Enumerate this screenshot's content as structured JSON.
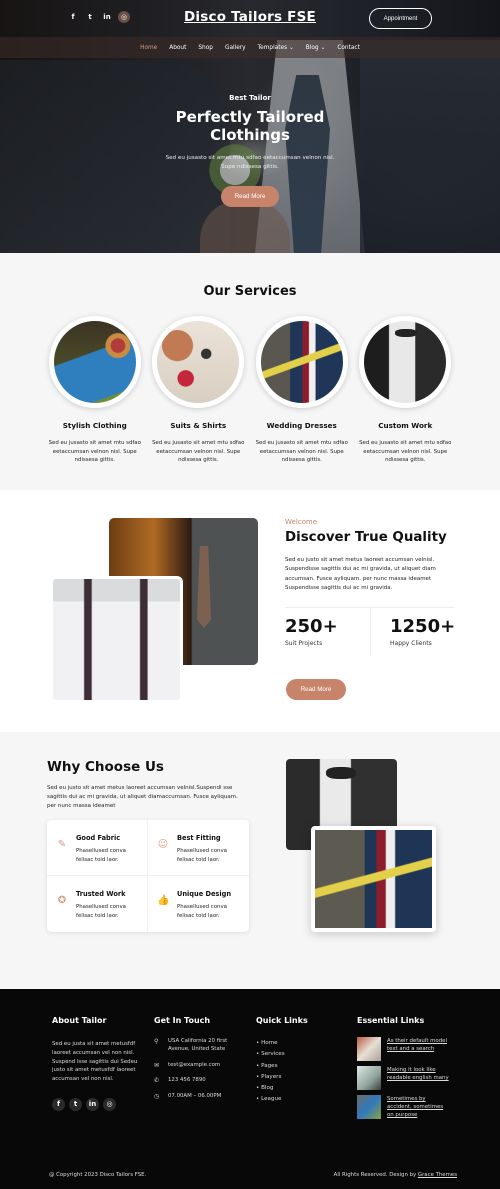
{
  "header": {
    "brand": "Disco Tailors FSE",
    "appointment_label": "Appointment",
    "socials": [
      {
        "icon": "facebook-icon",
        "glyph": "f"
      },
      {
        "icon": "twitter-icon",
        "glyph": "t"
      },
      {
        "icon": "linkedin-icon",
        "glyph": "in"
      },
      {
        "icon": "instagram-icon",
        "glyph": "◎"
      }
    ],
    "nav": [
      {
        "label": "Home",
        "current": true
      },
      {
        "label": "About"
      },
      {
        "label": "Shop"
      },
      {
        "label": "Gallery"
      },
      {
        "label": "Templates ⌄"
      },
      {
        "label": "Blog ⌄"
      },
      {
        "label": "Contact"
      }
    ]
  },
  "hero": {
    "eyebrow": "Best Tailor",
    "title_line1": "Perfectly Tailored",
    "title_line2": "Clothings",
    "text": "Sed eu jusasto sit amet mtu sdfao eetaccumsan velnon nisl. Supe ndissesa gittis.",
    "button": "Read More"
  },
  "services": {
    "title": "Our Services",
    "items": [
      {
        "name": "Stylish Clothing",
        "desc": "Sed eu jusasto sit amet mtu sdfao eetaccumsan velnon nisl. Supe ndissesa gittis.",
        "image": "sewing-machine"
      },
      {
        "name": "Suits & Shirts",
        "desc": "Sed eu jusasto sit amet mtu sdfao eetaccumsan velnon nisl. Supe ndissesa gittis.",
        "image": "buttons-and-thread"
      },
      {
        "name": "Wedding Dresses",
        "desc": "Sed eu jusasto sit amet mtu sdfao eetaccumsan velnon nisl. Supe ndissesa gittis.",
        "image": "measuring-suit"
      },
      {
        "name": "Custom Work",
        "desc": "Sed eu jusasto sit amet mtu sdfao eetaccumsan velnon nisl. Supe ndissesa gittis.",
        "image": "tuxedo"
      }
    ]
  },
  "about": {
    "eyebrow": "Welcome",
    "title": "Discover True Quality",
    "desc": "Sed eu justo sit amet metus laoreet accumsan velnisl. Suspendisse sagittis dui ac mi gravida, ut aliquet diam accumsan. Fusce ayliquam. per nunc massa ideamet Suspendisse sagittis dui ac mi gravida.",
    "stats": [
      {
        "value": "250+",
        "label": "Suit Projects"
      },
      {
        "value": "1250+",
        "label": "Happy Clients"
      }
    ],
    "button": "Read More"
  },
  "why": {
    "title": "Why Choose Us",
    "desc": "Sed eu justo sit amet metus laoreet accumsan velnisl.Suspendi sse sagittis dui ac mi gravida, ut aliquet diamaccumsan. Fusce ayliquam. per nunc massa ideamet",
    "features": [
      {
        "title": "Good Fabric",
        "desc": "Phasellused conva felisac toid laor.",
        "icon": "feather-icon",
        "glyph": "✎"
      },
      {
        "title": "Best Fitting",
        "desc": "Phasellused conva felisac toid laor.",
        "icon": "tailor-icon",
        "glyph": "☺"
      },
      {
        "title": "Trusted Work",
        "desc": "Phasellused conva felisac toid laor.",
        "icon": "award-icon",
        "glyph": "✪"
      },
      {
        "title": "Unique Design",
        "desc": "Phasellused conva felisac toid laor.",
        "icon": "thumbs-up-icon",
        "glyph": "👍"
      }
    ]
  },
  "footer": {
    "about": {
      "title": "About Tailor",
      "text": "Sed eu justa sit amet metusfdf laoreet accumsan vel non nisl. Suspend isse sagittis dui Sedeu justo sit amet metusfdf laoreet accumsan vel non nisl."
    },
    "contact": {
      "title": "Get In Touch",
      "items": [
        {
          "icon": "location-pin-icon",
          "glyph": "⚲",
          "text": "USA California 20 first Avenue, United State"
        },
        {
          "icon": "envelope-icon",
          "glyph": "✉",
          "text": "test@example.com"
        },
        {
          "icon": "phone-icon",
          "glyph": "✆",
          "text": "123 456 7890"
        },
        {
          "icon": "clock-icon",
          "glyph": "◷",
          "text": "07.00AM – 06.00PM"
        }
      ]
    },
    "quick_links": {
      "title": "Quick Links",
      "items": [
        "Home",
        "Services",
        "Pages",
        "Players",
        "Blog",
        "League"
      ]
    },
    "essential_links": {
      "title": "Essential Links",
      "items": [
        "As their default model text and a search",
        "Making it look like readable english many",
        "Sometimes by accident, sometimes on purpose"
      ]
    },
    "copyright": "@ Copyright 2023 Disco Tailors FSE.",
    "rights_prefix": "All Rights Reserved. Design by ",
    "designer": "Grace Themes"
  },
  "colors": {
    "accent": "#c8846b",
    "footer_bg": "#080808",
    "section_bg": "#f6f6f6"
  }
}
